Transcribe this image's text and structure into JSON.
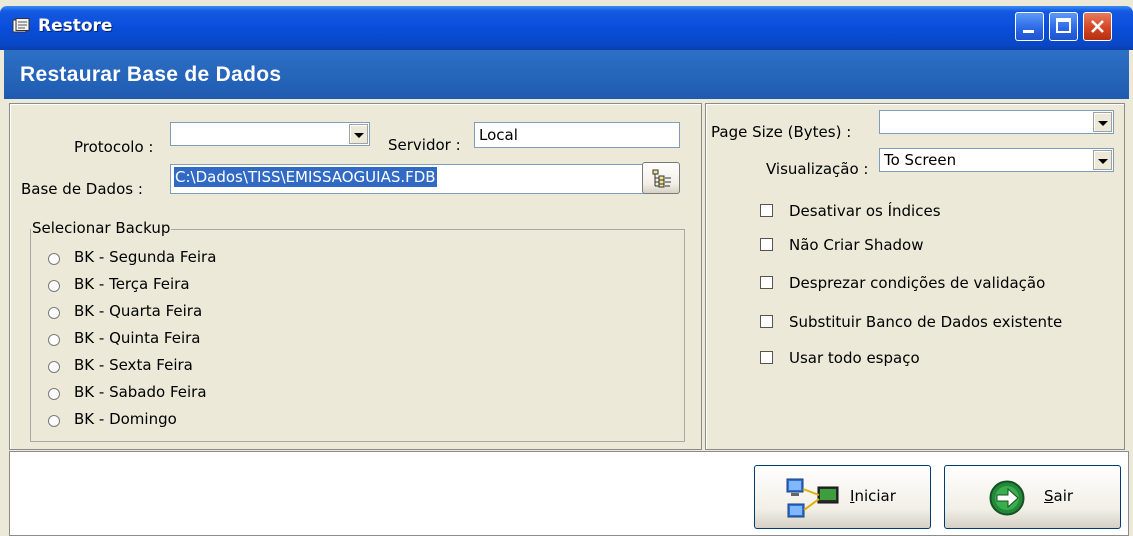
{
  "window": {
    "title": "Restore",
    "header": "Restaurar Base de Dados",
    "controls": [
      "minimize",
      "maximize",
      "close"
    ]
  },
  "form": {
    "protocolo_label": "Protocolo :",
    "protocolo_value": "",
    "servidor_label": "Servidor :",
    "servidor_value": "Local",
    "base_label": "Base de Dados :",
    "base_value": "C:\\Dados\\TISS\\EMISSAOGUIAS.FDB"
  },
  "backup": {
    "group_label": "Selecionar Backup",
    "options": [
      "BK - Segunda Feira",
      "BK - Terça Feira",
      "BK - Quarta Feira",
      "BK - Quinta Feira",
      "BK - Sexta Feira",
      "BK - Sabado Feira",
      "BK - Domingo"
    ]
  },
  "options": {
    "page_size_label": "Page Size (Bytes) :",
    "page_size_value": "",
    "visualizacao_label": "Visualização :",
    "visualizacao_value": "To Screen",
    "checks": [
      {
        "label": "Desativar os Índices",
        "checked": false
      },
      {
        "label": "Não Criar Shadow",
        "checked": false
      },
      {
        "label": "Desprezar condições de validação",
        "checked": false
      },
      {
        "label": "Substituir Banco de Dados existente",
        "checked": false
      },
      {
        "label": "Usar todo espaço",
        "checked": false
      }
    ]
  },
  "buttons": {
    "iniciar": "Iniciar",
    "sair": "Sair"
  },
  "colors": {
    "titlebar": "#0a4ddb",
    "header": "#245fb5",
    "window_bg": "#ece9d8",
    "selection": "#316ac5"
  }
}
